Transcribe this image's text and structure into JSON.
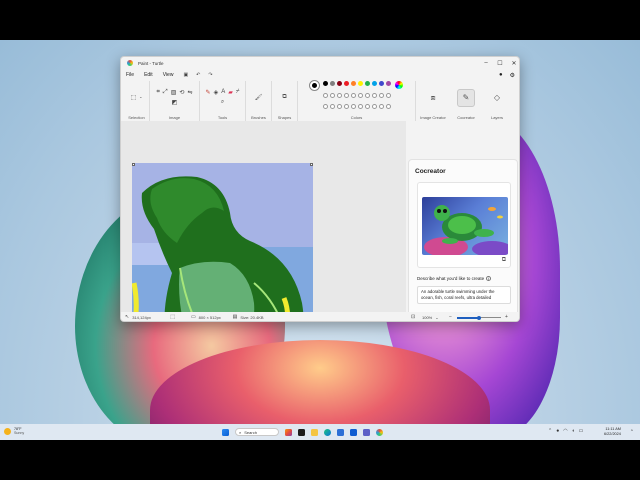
{
  "window": {
    "title": "Paint - Turtle"
  },
  "menu": {
    "file": "File",
    "edit": "Edit",
    "view": "View"
  },
  "ribbon": {
    "groups": {
      "selection": "Selection",
      "image": "Image",
      "tools": "Tools",
      "brushes": "Brushes",
      "shapes": "Shapes",
      "colors": "Colors",
      "image_creator": "Image Creator",
      "cocreator": "Cocreator",
      "layers": "Layers"
    },
    "swatch_colors": [
      "#000000",
      "#7f7f7f",
      "#880015",
      "#ed1c24",
      "#ff7f27",
      "#fff200",
      "#22b14c",
      "#00a2e8",
      "#3f48cc",
      "#a349a4"
    ]
  },
  "cocreator": {
    "title": "Cocreator",
    "prompt_label": "Describe what you'd like to create",
    "prompt_text": "An adorable turtle swimming under the ocean, fish, coral reefs, ultra detailed",
    "creativity_label": "Creativity",
    "creativity_level": 0.4
  },
  "status": {
    "cursor": "314,124px",
    "dimensions": "800 × 512px",
    "size": "Size: 20.4KB",
    "zoom": "100%",
    "zoom_level": 0.5
  },
  "taskbar": {
    "weather_temp": "78°F",
    "weather_desc": "Sunny",
    "search_placeholder": "Search",
    "time": "11:11 AM",
    "date": "6/22/2024"
  }
}
